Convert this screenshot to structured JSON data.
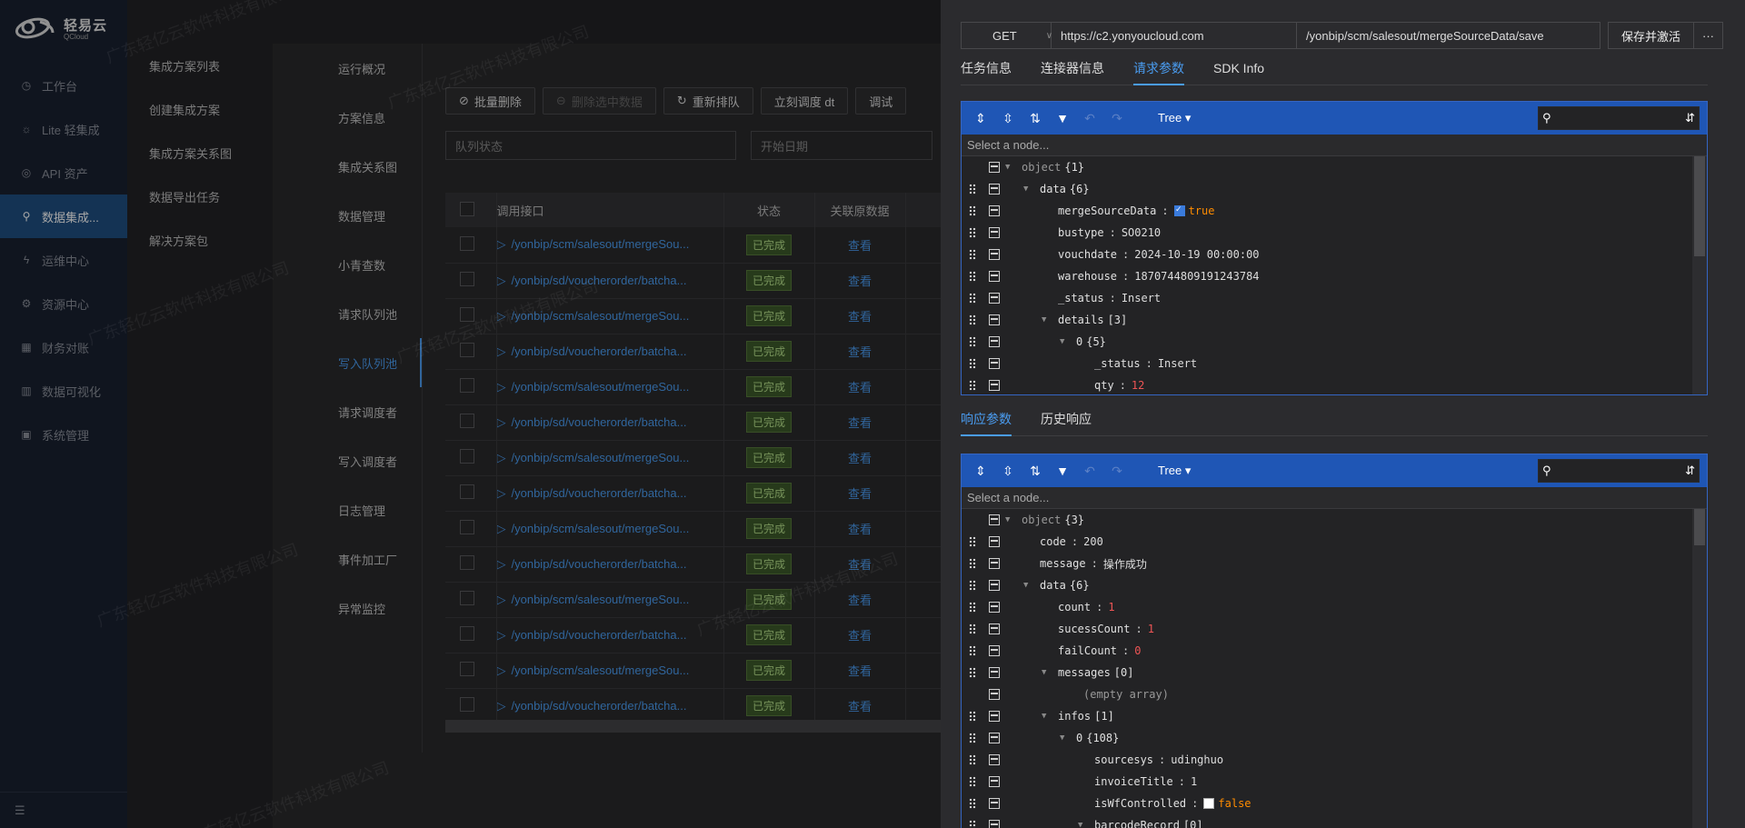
{
  "logo": {
    "cn": "轻易云",
    "en": "QCloud"
  },
  "nav": [
    {
      "label": "工作台",
      "icon": "clock-icon",
      "glyph": "◷"
    },
    {
      "label": "Lite 轻集成",
      "icon": "bulb-icon",
      "glyph": "☼"
    },
    {
      "label": "API 资产",
      "icon": "compass-icon",
      "glyph": "◎"
    },
    {
      "label": "数据集成...",
      "icon": "share-icon",
      "glyph": "⚲"
    },
    {
      "label": "运维中心",
      "icon": "bolt-icon",
      "glyph": "ϟ"
    },
    {
      "label": "资源中心",
      "icon": "nodes-icon",
      "glyph": "⚙"
    },
    {
      "label": "财务对账",
      "icon": "grid-icon",
      "glyph": "▦"
    },
    {
      "label": "数据可视化",
      "icon": "chart-icon",
      "glyph": "▥"
    },
    {
      "label": "系统管理",
      "icon": "apps-icon",
      "glyph": "▣"
    }
  ],
  "subnav": [
    "集成方案列表",
    "创建集成方案",
    "集成方案关系图",
    "数据导出任务",
    "解决方案包"
  ],
  "leftmenu": [
    "运行概况",
    "方案信息",
    "集成关系图",
    "数据管理",
    "小青查数",
    "请求队列池",
    "写入队列池",
    "请求调度者",
    "写入调度者",
    "日志管理",
    "事件加工厂",
    "异常监控"
  ],
  "toolbar": {
    "batch_delete": "批量删除",
    "delete_selected": "删除选中数据",
    "requeue": "重新排队",
    "dispatch_now": "立刻调度 dt",
    "debug": "调试"
  },
  "filters": {
    "queue_status": "队列状态",
    "start_date": "开始日期"
  },
  "table": {
    "headers": {
      "api": "调用接口",
      "status": "状态",
      "related": "关联原数据"
    },
    "rows": [
      {
        "api": "/yonbip/scm/salesout/mergeSou...",
        "status": "已完成",
        "link": "查看"
      },
      {
        "api": "/yonbip/sd/voucherorder/batcha...",
        "status": "已完成",
        "link": "查看"
      },
      {
        "api": "/yonbip/scm/salesout/mergeSou...",
        "status": "已完成",
        "link": "查看"
      },
      {
        "api": "/yonbip/sd/voucherorder/batcha...",
        "status": "已完成",
        "link": "查看"
      },
      {
        "api": "/yonbip/scm/salesout/mergeSou...",
        "status": "已完成",
        "link": "查看"
      },
      {
        "api": "/yonbip/sd/voucherorder/batcha...",
        "status": "已完成",
        "link": "查看"
      },
      {
        "api": "/yonbip/scm/salesout/mergeSou...",
        "status": "已完成",
        "link": "查看"
      },
      {
        "api": "/yonbip/sd/voucherorder/batcha...",
        "status": "已完成",
        "link": "查看"
      },
      {
        "api": "/yonbip/scm/salesout/mergeSou...",
        "status": "已完成",
        "link": "查看"
      },
      {
        "api": "/yonbip/sd/voucherorder/batcha...",
        "status": "已完成",
        "link": "查看"
      },
      {
        "api": "/yonbip/scm/salesout/mergeSou...",
        "status": "已完成",
        "link": "查看"
      },
      {
        "api": "/yonbip/sd/voucherorder/batcha...",
        "status": "已完成",
        "link": "查看"
      },
      {
        "api": "/yonbip/scm/salesout/mergeSou...",
        "status": "已完成",
        "link": "查看"
      },
      {
        "api": "/yonbip/sd/voucherorder/batcha...",
        "status": "已完成",
        "link": "查看"
      }
    ]
  },
  "drawer": {
    "method": "GET",
    "host": "https://c2.yonyoucloud.com",
    "path": "/yonbip/scm/salesout/mergeSourceData/save",
    "save_label": "保存并激活",
    "more_label": "···",
    "tabs": [
      "任务信息",
      "连接器信息",
      "请求参数",
      "SDK Info"
    ],
    "tabs2": [
      "响应参数",
      "历史响应"
    ],
    "editor_mode": "Tree",
    "nav_placeholder": "Select a node..."
  },
  "request_tree": [
    {
      "depth": 0,
      "tri": "▼",
      "key": "object",
      "meta": "{1}",
      "drag": false
    },
    {
      "depth": 1,
      "tri": "▼",
      "key": "data",
      "meta": "{6}",
      "drag": true
    },
    {
      "depth": 2,
      "key": "mergeSourceData",
      "check": true,
      "value": "true",
      "type": "bool",
      "drag": true
    },
    {
      "depth": 2,
      "key": "bustype",
      "value": "SO0210",
      "type": "str",
      "drag": true
    },
    {
      "depth": 2,
      "key": "vouchdate",
      "value": "2024-10-19 00:00:00",
      "type": "str",
      "drag": true
    },
    {
      "depth": 2,
      "key": "warehouse",
      "value": "1870744809191243784",
      "type": "str",
      "drag": true
    },
    {
      "depth": 2,
      "key": "_status",
      "value": "Insert",
      "type": "str",
      "drag": true
    },
    {
      "depth": 2,
      "tri": "▼",
      "key": "details",
      "meta": "[3]",
      "drag": true
    },
    {
      "depth": 3,
      "tri": "▼",
      "key": "0",
      "meta": "{5}",
      "drag": true
    },
    {
      "depth": 4,
      "key": "_status",
      "value": "Insert",
      "type": "str",
      "drag": true
    },
    {
      "depth": 4,
      "key": "qty",
      "value": "12",
      "type": "num",
      "drag": true
    }
  ],
  "response_tree": [
    {
      "depth": 0,
      "tri": "▼",
      "key": "object",
      "meta": "{3}",
      "drag": false
    },
    {
      "depth": 1,
      "key": "code",
      "value": "200",
      "type": "str",
      "drag": true
    },
    {
      "depth": 1,
      "key": "message",
      "value": "操作成功",
      "type": "str",
      "drag": true
    },
    {
      "depth": 1,
      "tri": "▼",
      "key": "data",
      "meta": "{6}",
      "drag": true
    },
    {
      "depth": 2,
      "key": "count",
      "value": "1",
      "type": "num",
      "drag": true
    },
    {
      "depth": 2,
      "key": "sucessCount",
      "value": "1",
      "type": "num",
      "drag": true
    },
    {
      "depth": 2,
      "key": "failCount",
      "value": "0",
      "type": "num",
      "drag": true
    },
    {
      "depth": 2,
      "tri": "▼",
      "key": "messages",
      "meta": "[0]",
      "drag": true
    },
    {
      "depth": 3,
      "key": "(empty array)",
      "type": "empty",
      "drag": false
    },
    {
      "depth": 2,
      "tri": "▼",
      "key": "infos",
      "meta": "[1]",
      "drag": true
    },
    {
      "depth": 3,
      "tri": "▼",
      "key": "0",
      "meta": "{108}",
      "drag": true
    },
    {
      "depth": 4,
      "key": "sourcesys",
      "value": "udinghuo",
      "type": "str",
      "drag": true
    },
    {
      "depth": 4,
      "key": "invoiceTitle",
      "value": "1",
      "type": "str",
      "drag": true
    },
    {
      "depth": 4,
      "key": "isWfControlled",
      "check": false,
      "value": "false",
      "type": "bool",
      "drag": true
    },
    {
      "depth": 4,
      "tri": "▼",
      "key": "barcodeRecord",
      "meta": "[0]",
      "drag": true
    }
  ],
  "watermark": "广东轻亿云软件科技有限公司"
}
